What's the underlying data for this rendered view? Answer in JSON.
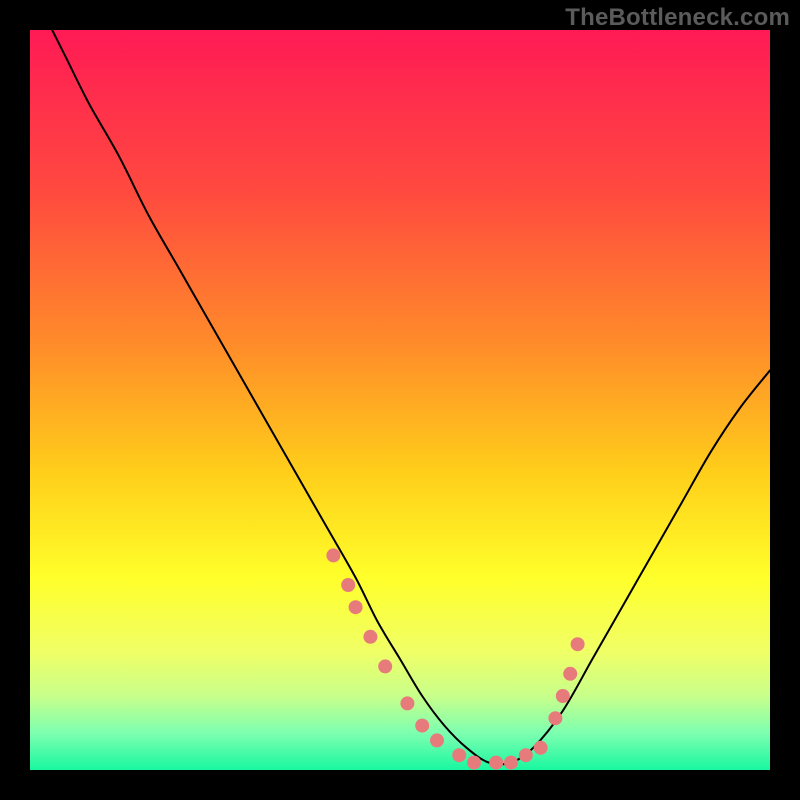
{
  "watermark": "TheBottleneck.com",
  "chart_data": {
    "type": "line",
    "title": "",
    "xlabel": "",
    "ylabel": "",
    "xlim": [
      0,
      100
    ],
    "ylim": [
      0,
      100
    ],
    "grid": false,
    "legend": false,
    "gradient_stops": [
      {
        "t": 0.0,
        "color": "#ff1a55"
      },
      {
        "t": 0.22,
        "color": "#ff4a3f"
      },
      {
        "t": 0.42,
        "color": "#ff8a2a"
      },
      {
        "t": 0.6,
        "color": "#ffcf1a"
      },
      {
        "t": 0.74,
        "color": "#ffff2a"
      },
      {
        "t": 0.84,
        "color": "#f0ff66"
      },
      {
        "t": 0.9,
        "color": "#c8ff8a"
      },
      {
        "t": 0.95,
        "color": "#7dffb0"
      },
      {
        "t": 1.0,
        "color": "#19f7a0"
      }
    ],
    "series": [
      {
        "name": "bottleneck-curve",
        "color": "#000000",
        "x": [
          3,
          5,
          8,
          12,
          16,
          20,
          24,
          28,
          32,
          36,
          40,
          44,
          47,
          50,
          53,
          56,
          59,
          62,
          65,
          68,
          72,
          76,
          80,
          84,
          88,
          92,
          96,
          100
        ],
        "y": [
          100,
          96,
          90,
          83,
          75,
          68,
          61,
          54,
          47,
          40,
          33,
          26,
          20,
          15,
          10,
          6,
          3,
          1,
          1,
          3,
          8,
          15,
          22,
          29,
          36,
          43,
          49,
          54
        ]
      }
    ],
    "markers": {
      "name": "curve-dots",
      "color": "#e77b7b",
      "radius": 7,
      "x": [
        41,
        43,
        44,
        46,
        48,
        51,
        53,
        55,
        58,
        60,
        63,
        65,
        67,
        69,
        71,
        72,
        73,
        74
      ],
      "y": [
        29,
        25,
        22,
        18,
        14,
        9,
        6,
        4,
        2,
        1,
        1,
        1,
        2,
        3,
        7,
        10,
        13,
        17
      ]
    }
  }
}
